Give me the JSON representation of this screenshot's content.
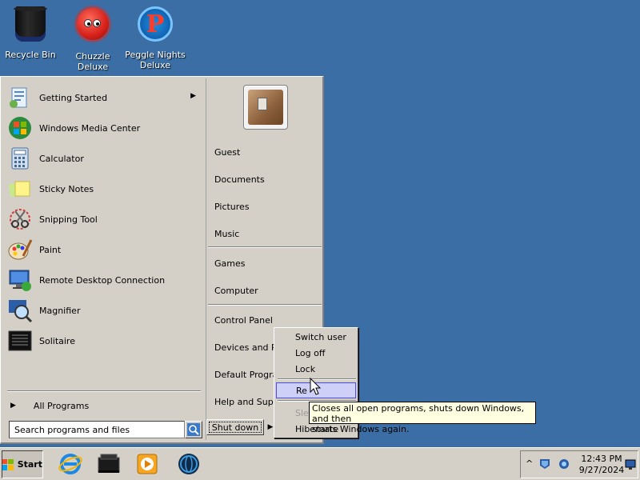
{
  "desktop": {
    "icons": [
      {
        "label": "Recycle Bin",
        "icon": "recycle-bin-icon"
      },
      {
        "label": "Chuzzle Deluxe",
        "icon": "chuzzle-icon"
      },
      {
        "label": "Peggle Nights Deluxe",
        "icon": "peggle-icon"
      }
    ],
    "background_color": "#3a6ea5"
  },
  "start_menu": {
    "programs": [
      {
        "label": "Getting Started",
        "icon": "getting-started-icon",
        "has_submenu": true
      },
      {
        "label": "Windows Media Center",
        "icon": "media-center-icon"
      },
      {
        "label": "Calculator",
        "icon": "calculator-icon"
      },
      {
        "label": "Sticky Notes",
        "icon": "sticky-notes-icon"
      },
      {
        "label": "Snipping Tool",
        "icon": "snipping-tool-icon"
      },
      {
        "label": "Paint",
        "icon": "paint-icon"
      },
      {
        "label": "Remote Desktop Connection",
        "icon": "remote-desktop-icon"
      },
      {
        "label": "Magnifier",
        "icon": "magnifier-icon"
      },
      {
        "label": "Solitaire",
        "icon": "solitaire-icon"
      }
    ],
    "all_programs": "All Programs",
    "search_placeholder": "Search programs and files",
    "right_items": {
      "guest": "Guest",
      "documents": "Documents",
      "pictures": "Pictures",
      "music": "Music",
      "games": "Games",
      "computer": "Computer",
      "control_panel": "Control Panel",
      "devices": "Devices and Prin",
      "default_programs": "Default Program",
      "help": "Help and Suppo"
    },
    "shutdown_label": "Shut down"
  },
  "power_menu": {
    "switch_user": "Switch user",
    "log_off": "Log off",
    "lock": "Lock",
    "restart": "Re",
    "sleep": "Slee",
    "hibernate": "Hibernate"
  },
  "tooltip": {
    "line1": "Closes all open programs, shuts down Windows, and then",
    "line2": "starts Windows again."
  },
  "taskbar": {
    "start_label": "Start",
    "pinned": [
      "internet-explorer-icon",
      "file-manager-icon",
      "media-player-icon",
      "globe-icon"
    ],
    "clock_time": "12:43 PM",
    "clock_date": "9/27/2024",
    "tray_expand": "^"
  },
  "colors": {
    "menu_face": "#d4d0c8",
    "hover_highlight": "#cfd0f7",
    "tooltip_bg": "#ffffe1"
  }
}
